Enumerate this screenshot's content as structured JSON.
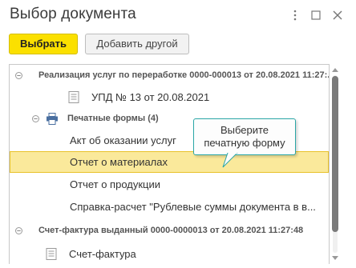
{
  "window": {
    "title": "Выбор документа"
  },
  "toolbar": {
    "select_label": "Выбрать",
    "add_other_label": "Добавить другой"
  },
  "list": {
    "rows": [
      {
        "kind": "group",
        "text": "Реализация услуг по переработке 0000-000013 от 20.08.2021 11:27:..."
      },
      {
        "kind": "item",
        "text": "УПД № 13 от 20.08.2021"
      },
      {
        "kind": "subgroup",
        "text": "Печатные формы (4)"
      },
      {
        "kind": "item",
        "text": "Акт об оказании услуг"
      },
      {
        "kind": "item",
        "text": "Отчет о материалах",
        "selected": true
      },
      {
        "kind": "item",
        "text": "Отчет о продукции"
      },
      {
        "kind": "item",
        "text": "Справка-расчет \"Рублевые суммы документа в в..."
      },
      {
        "kind": "group",
        "text": "Счет-фактура выданный 0000-0000013 от 20.08.2021 11:27:48"
      },
      {
        "kind": "item",
        "text": "Счет-фактура"
      }
    ]
  },
  "tooltip": {
    "line1": "Выберите",
    "line2": "печатную форму"
  },
  "colors": {
    "primary_button": "#fbe000",
    "selection_fill": "#fae99b",
    "selection_border": "#e8c22a",
    "tooltip_border": "#2aa6a6"
  },
  "icons": [
    "more-vert-icon",
    "maximize-icon",
    "close-icon",
    "collapse-toggle-icon",
    "document-icon",
    "printer-icon"
  ]
}
